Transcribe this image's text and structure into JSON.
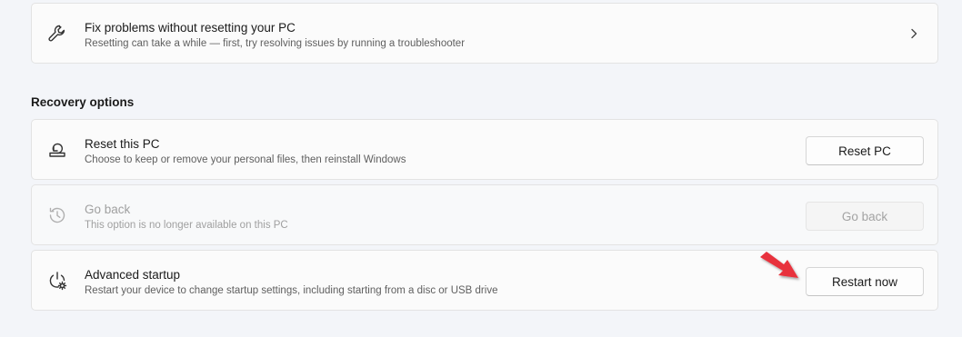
{
  "fix_card": {
    "title": "Fix problems without resetting your PC",
    "description": "Resetting can take a while — first, try resolving issues by running a troubleshooter",
    "icon": "wrench-icon"
  },
  "recovery": {
    "heading": "Recovery options",
    "items": [
      {
        "title": "Reset this PC",
        "description": "Choose to keep or remove your personal files, then reinstall Windows",
        "button": "Reset PC",
        "icon": "reset-pc-icon",
        "enabled": true
      },
      {
        "title": "Go back",
        "description": "This option is no longer available on this PC",
        "button": "Go back",
        "icon": "history-icon",
        "enabled": false
      },
      {
        "title": "Advanced startup",
        "description": "Restart your device to change startup settings, including starting from a disc or USB drive",
        "button": "Restart now",
        "icon": "power-settings-icon",
        "enabled": true
      }
    ]
  },
  "colors": {
    "background": "#f3f5f9",
    "card": "#fbfbfb",
    "annotation_arrow": "#e8323c"
  }
}
